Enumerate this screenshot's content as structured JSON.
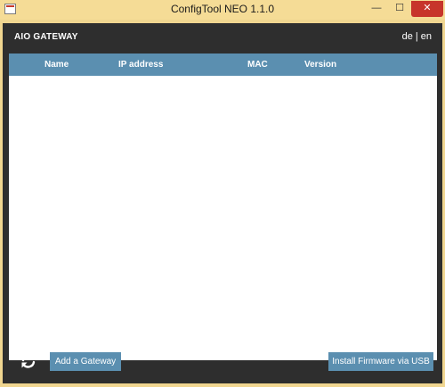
{
  "window": {
    "title": "ConfigTool NEO 1.1.0",
    "minimize_glyph": "—",
    "maximize_glyph": "☐",
    "close_glyph": "✕"
  },
  "header": {
    "brand": "AIO GATEWAY",
    "lang_de": "de",
    "lang_separator": "|",
    "lang_en": "en"
  },
  "table": {
    "columns": [
      "Name",
      "IP address",
      "MAC",
      "Version"
    ],
    "rows": []
  },
  "footer": {
    "refresh_icon": "refresh-icon",
    "add_gateway_label": "Add a Gateway",
    "install_firmware_label": "Install Firmware via USB"
  },
  "colors": {
    "frame": "#f0d690",
    "client_bg": "#2e2e2e",
    "accent": "#5b8fb0",
    "close": "#c7352b"
  }
}
